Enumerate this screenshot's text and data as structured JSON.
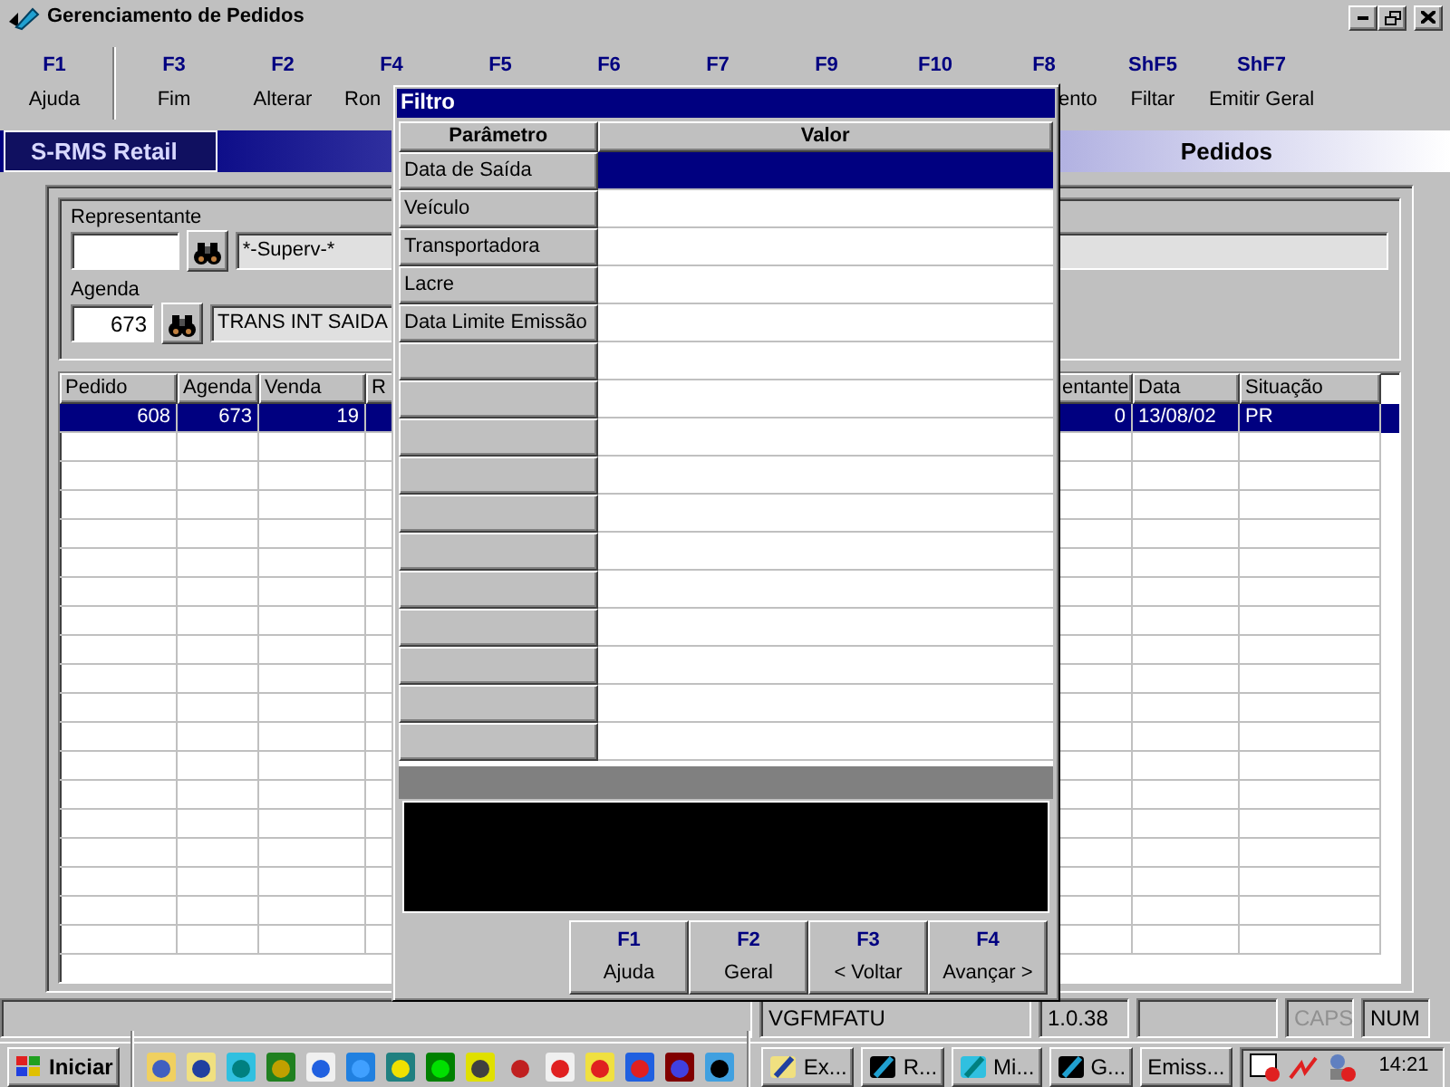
{
  "window": {
    "title": "Gerenciamento de Pedidos"
  },
  "toolbar": [
    {
      "key": "F1",
      "label": "Ajuda"
    },
    {
      "key": "F3",
      "label": "Fim"
    },
    {
      "key": "F2",
      "label": "Alterar"
    },
    {
      "key": "F4",
      "label": "Ron"
    },
    {
      "key": "F5"
    },
    {
      "key": "F6"
    },
    {
      "key": "F7"
    },
    {
      "key": "F9"
    },
    {
      "key": "F10"
    },
    {
      "key": "F8",
      "label": "ento"
    },
    {
      "key": "ShF5",
      "label": "Filtar"
    },
    {
      "key": "ShF7",
      "label": "Emitir Geral"
    }
  ],
  "banner": {
    "product": "S-RMS Retail",
    "screen": "Pedidos"
  },
  "form": {
    "fields": [
      {
        "label": "Representante",
        "description": "*-Superv-*"
      },
      {
        "label": "Agenda",
        "code": "673",
        "description": "TRANS INT SAIDA"
      }
    ]
  },
  "table": {
    "columns": [
      "Pedido",
      "Agenda",
      "Venda",
      "R",
      "entante",
      "Data",
      "Situação"
    ],
    "rows": [
      {
        "selected": true,
        "cells": [
          "608",
          "673",
          "19",
          null,
          "0",
          "13/08/02",
          "PR"
        ]
      }
    ]
  },
  "dialog": {
    "title": "Filtro",
    "columns": [
      "Parâmetro",
      "Valor"
    ],
    "rows": [
      {
        "parameter": "Data de Saída",
        "selected": true
      },
      {
        "parameter": "Veículo",
        "selected": false
      },
      {
        "parameter": "Transportadora",
        "selected": false
      },
      {
        "parameter": "Lacre",
        "selected": false
      },
      {
        "parameter": "Data Limite Emissão",
        "selected": false
      }
    ],
    "buttons": [
      {
        "key": "F1",
        "label": "Ajuda"
      },
      {
        "key": "F2",
        "label": "Geral"
      },
      {
        "key": "F3",
        "label": "< Voltar"
      },
      {
        "key": "F4",
        "label": "Avançar >"
      }
    ]
  },
  "status_bar": {
    "panels": [
      {
        "kind": "blank"
      },
      {
        "kind": "text",
        "text": "VGFMFATU"
      },
      {
        "kind": "text",
        "text": "1.0.38"
      },
      {
        "kind": "blank"
      },
      {
        "kind": "text",
        "text": "CAPS",
        "on": false
      },
      {
        "kind": "text",
        "text": "NUM",
        "on": true
      }
    ]
  },
  "taskbar": {
    "start": "Iniciar",
    "tasks": [
      {
        "label": "Ex..."
      },
      {
        "label": "R..."
      },
      {
        "label": "Mi..."
      },
      {
        "label": "G..."
      },
      {
        "label": "Emiss..."
      }
    ],
    "clock": "14:21"
  }
}
